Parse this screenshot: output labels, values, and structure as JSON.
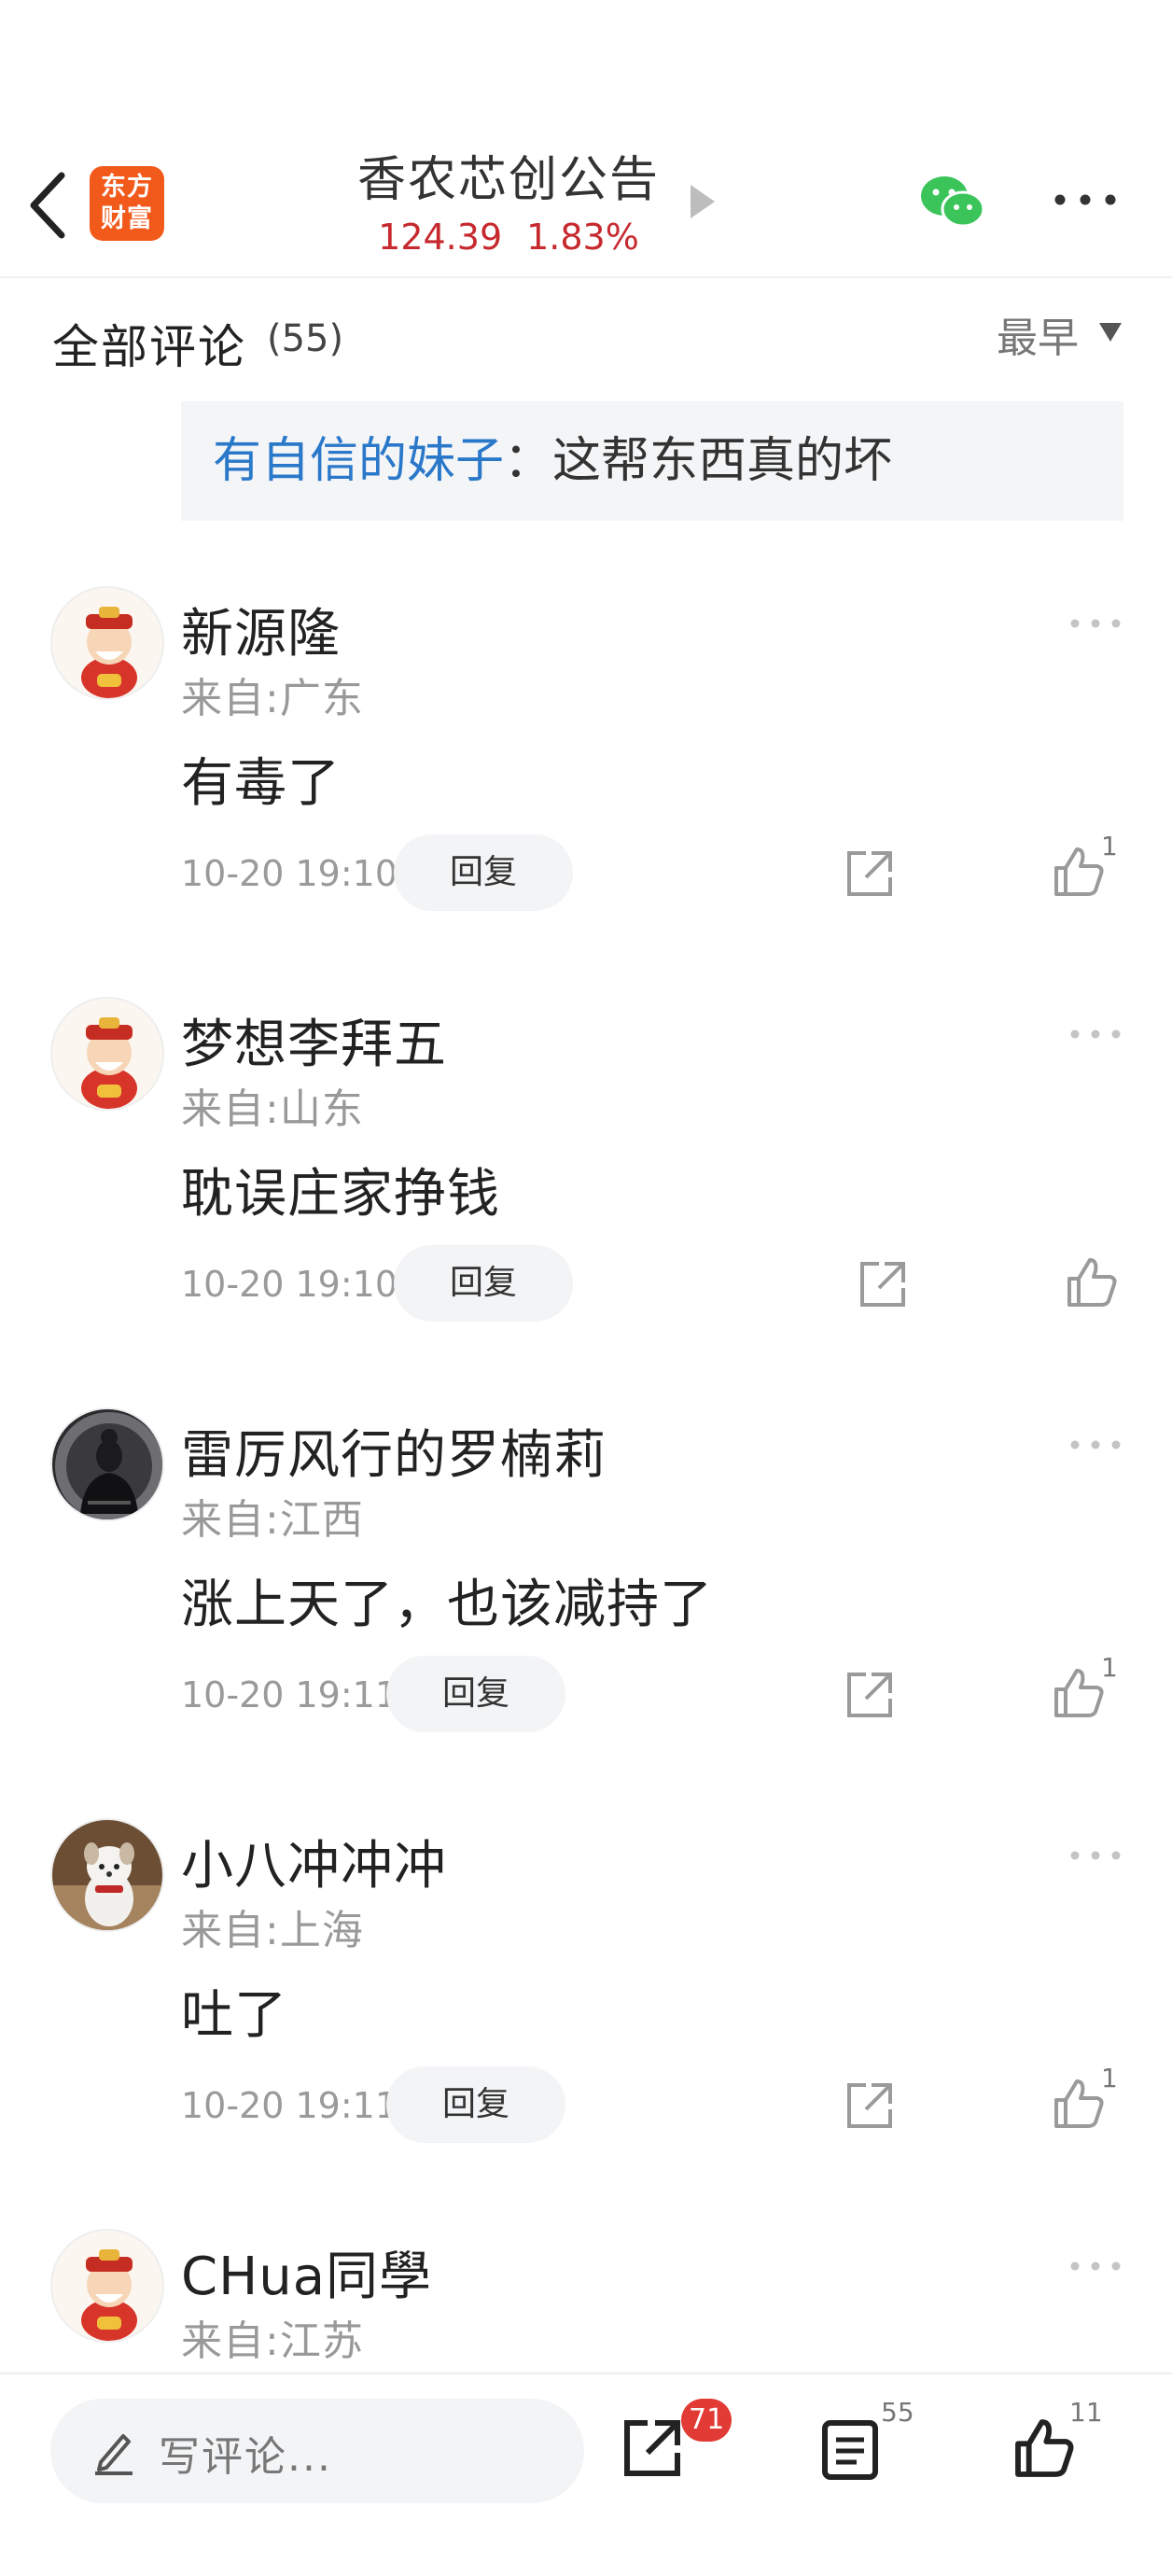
{
  "header": {
    "logo_line1": "东方",
    "logo_line2": "财富",
    "title": "香农芯创公告",
    "price": "124.39",
    "change": "1.83%"
  },
  "section": {
    "title": "全部评论",
    "count": "(55)",
    "sort_label": "最早"
  },
  "quote": {
    "user": "有自信的妹子",
    "text": "：这帮东西真的坏"
  },
  "comments": [
    {
      "name": "新源隆",
      "location": "来自:广东",
      "content": "有毒了",
      "time": "10-20 19:10",
      "reply": "回复",
      "likes": "1"
    },
    {
      "name": "梦想李拜五",
      "location": "来自:山东",
      "content": "耽误庄家挣钱",
      "time": "10-20 19:10",
      "reply": "回复",
      "likes": ""
    },
    {
      "name": "雷厉风行的罗楠莉",
      "location": "来自:江西",
      "content": "涨上天了，也该减持了",
      "time": "10-20 19:11",
      "reply": "回复",
      "likes": "1"
    },
    {
      "name": "小八冲冲冲",
      "location": "来自:上海",
      "content": "吐了",
      "time": "10-20 19:11",
      "reply": "回复",
      "likes": "1"
    },
    {
      "name": "CHua同學",
      "location": "来自:江苏",
      "content": "",
      "time": "",
      "reply": "",
      "likes": ""
    }
  ],
  "bottom_bar": {
    "compose_placeholder": "写评论...",
    "share_badge": "71",
    "comment_count": "55",
    "like_count": "11"
  },
  "colors": {
    "price_red": "#c6292e",
    "link_blue": "#2a78c9",
    "brand_orange": "#f25a1c",
    "badge_red": "#e23a34",
    "wechat_green": "#3bc45a"
  }
}
